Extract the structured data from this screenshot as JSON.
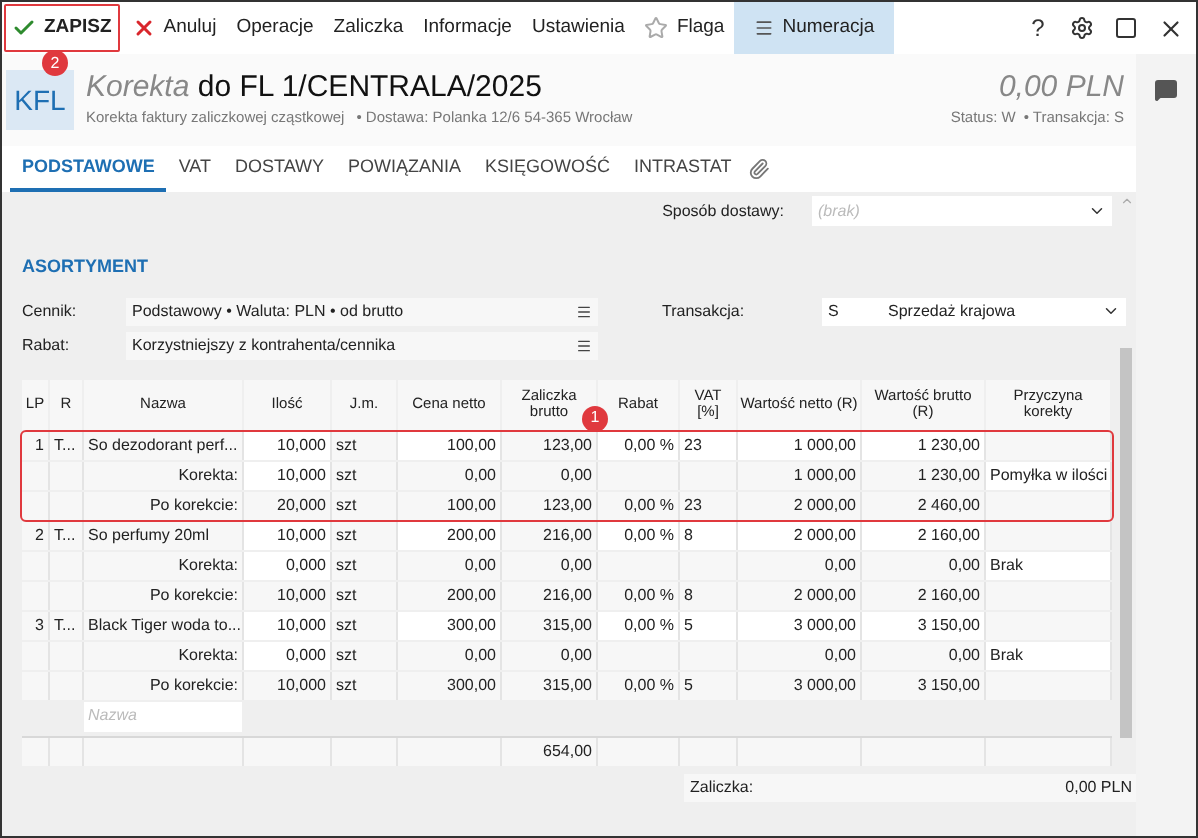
{
  "toolbar": {
    "buttons": [
      {
        "kind": "save",
        "label": "ZAPISZ",
        "badge": "2",
        "highlighted": true
      },
      {
        "kind": "cancel",
        "label": "Anuluj"
      },
      {
        "kind": "plain",
        "label": "Operacje"
      },
      {
        "kind": "plain",
        "label": "Zaliczka"
      },
      {
        "kind": "plain",
        "label": "Informacje"
      },
      {
        "kind": "plain",
        "label": "Ustawienia"
      },
      {
        "kind": "flag",
        "label": "Flaga"
      },
      {
        "kind": "numbering",
        "label": "Numeracja"
      }
    ],
    "help": "?"
  },
  "header": {
    "badge": "KFL",
    "title_prefix": "Korekta",
    "title": "do FL 1/CENTRALA/2025",
    "subtitle": "Korekta faktury zaliczkowej cząstkowej",
    "delivery": "• Dostawa: Polanka  12/6  54-365 Wrocław",
    "amount": "0,00 PLN",
    "status": "Status:  W",
    "transaction": "• Transakcja:  S"
  },
  "tabs": [
    {
      "label": "PODSTAWOWE",
      "selected": true
    },
    {
      "label": "VAT",
      "selected": false
    },
    {
      "label": "DOSTAWY",
      "selected": false
    },
    {
      "label": "POWIĄZANIA",
      "selected": false
    },
    {
      "label": "KSIĘGOWOŚĆ",
      "selected": false
    },
    {
      "label": "INTRASTAT",
      "selected": false
    }
  ],
  "delivery_method": {
    "label": "Sposób dostawy:",
    "placeholder": "(brak)"
  },
  "section_title": "ASORTYMENT",
  "cennik": {
    "label": "Cennik:",
    "value": "Podstawowy • Waluta: PLN • od brutto"
  },
  "rabat": {
    "label": "Rabat:",
    "value": "Korzystniejszy z kontrahenta/cennika"
  },
  "transakcja": {
    "label": "Transakcja:",
    "code": "S",
    "value": "Sprzedaż krajowa"
  },
  "table": {
    "columns": [
      "LP",
      "R",
      "Nazwa",
      "Ilość",
      "J.m.",
      "Cena netto",
      "Zaliczka brutto",
      "Rabat",
      "VAT [%]",
      "Wartość netto (R)",
      "Wartość brutto (R)",
      "Przyczyna korekty"
    ],
    "header_badge": "1",
    "groups": [
      {
        "highlighted": true,
        "rows": [
          {
            "kind": "item",
            "lp": "1",
            "r": "T...",
            "nazwa": "So dezodorant perf...",
            "ilosc": "10,000",
            "jm": "szt",
            "cena": "100,00",
            "zaliczka": "123,00",
            "rabat": "0,00 %",
            "vat": "23",
            "netto": "1 000,00",
            "brutto": "1 230,00"
          },
          {
            "kind": "correction",
            "nazwa": "Korekta:",
            "ilosc": "10,000",
            "jm": "szt",
            "cena": "0,00",
            "zaliczka": "0,00",
            "netto": "1 000,00",
            "brutto": "1 230,00",
            "przyczyna": "Pomyłka w ilości"
          },
          {
            "kind": "after",
            "nazwa": "Po korekcie:",
            "ilosc": "20,000",
            "jm": "szt",
            "cena": "100,00",
            "zaliczka": "123,00",
            "rabat": "0,00 %",
            "vat": "23",
            "netto": "2 000,00",
            "brutto": "2 460,00"
          }
        ]
      },
      {
        "highlighted": false,
        "rows": [
          {
            "kind": "item",
            "lp": "2",
            "r": "T...",
            "nazwa": "So perfumy 20ml",
            "ilosc": "10,000",
            "jm": "szt",
            "cena": "200,00",
            "zaliczka": "216,00",
            "rabat": "0,00 %",
            "vat": "8",
            "netto": "2 000,00",
            "brutto": "2 160,00"
          },
          {
            "kind": "correction",
            "nazwa": "Korekta:",
            "ilosc": "0,000",
            "jm": "szt",
            "cena": "0,00",
            "zaliczka": "0,00",
            "netto": "0,00",
            "brutto": "0,00",
            "przyczyna": "Brak"
          },
          {
            "kind": "after",
            "nazwa": "Po korekcie:",
            "ilosc": "10,000",
            "jm": "szt",
            "cena": "200,00",
            "zaliczka": "216,00",
            "rabat": "0,00 %",
            "vat": "8",
            "netto": "2 000,00",
            "brutto": "2 160,00"
          }
        ]
      },
      {
        "highlighted": false,
        "rows": [
          {
            "kind": "item",
            "lp": "3",
            "r": "T...",
            "nazwa": "Black Tiger woda to...",
            "ilosc": "10,000",
            "jm": "szt",
            "cena": "300,00",
            "zaliczka": "315,00",
            "rabat": "0,00 %",
            "vat": "5",
            "netto": "3 000,00",
            "brutto": "3 150,00"
          },
          {
            "kind": "correction",
            "nazwa": "Korekta:",
            "ilosc": "0,000",
            "jm": "szt",
            "cena": "0,00",
            "zaliczka": "0,00",
            "netto": "0,00",
            "brutto": "0,00",
            "przyczyna": "Brak"
          },
          {
            "kind": "after",
            "nazwa": "Po korekcie:",
            "ilosc": "10,000",
            "jm": "szt",
            "cena": "300,00",
            "zaliczka": "315,00",
            "rabat": "0,00 %",
            "vat": "5",
            "netto": "3 000,00",
            "brutto": "3 150,00"
          }
        ]
      }
    ],
    "new_row_placeholder": "Nazwa",
    "total_zaliczka": "654,00"
  },
  "footer": {
    "label": "Zaliczka:",
    "value": "0,00 PLN"
  }
}
